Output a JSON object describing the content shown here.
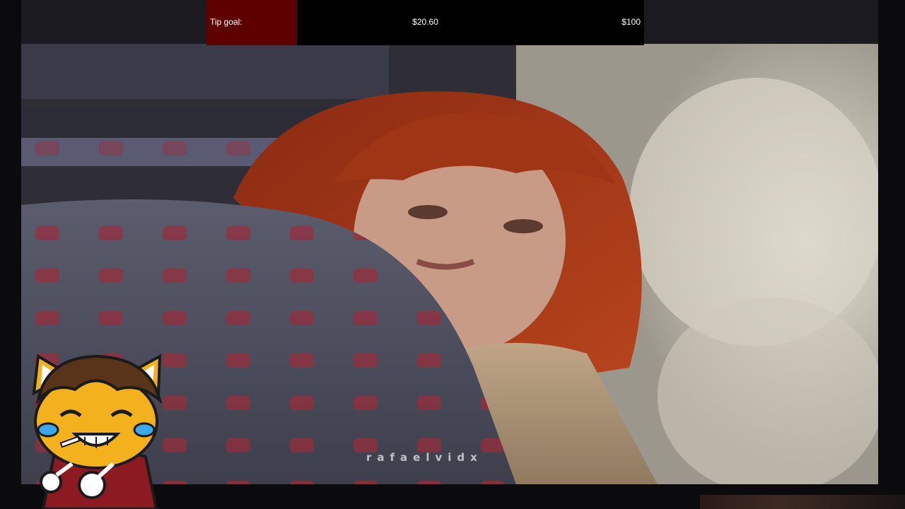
{
  "stream": {
    "tip_goal": {
      "label": "Tip goal:",
      "current": "$20.60",
      "target": "$100",
      "progress": 0.206,
      "fill_color": "#5e0000",
      "bar_color": "#000000"
    },
    "watermark": "rafaelvidx",
    "mascot": {
      "icon": "cat-mascot-icon"
    }
  }
}
